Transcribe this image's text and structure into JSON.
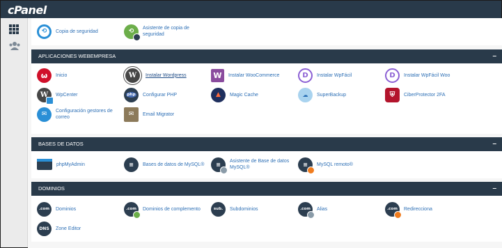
{
  "app": {
    "logo": "cPanel"
  },
  "sidebar": [
    {
      "icon": "grid-icon"
    },
    {
      "icon": "users-icon"
    }
  ],
  "top_items": [
    {
      "label": "Copia de seguridad",
      "icon": "backup-icon"
    },
    {
      "label": "Asistente de copia de seguridad",
      "icon": "backup-wizard-icon"
    }
  ],
  "sections": {
    "webempresa": {
      "title": "APLICACIONES WEBEMPRESA",
      "collapse": "–",
      "items": [
        {
          "label": "Inicio",
          "icon": "webempresa-logo-icon"
        },
        {
          "label": "Instalar Wordpress",
          "icon": "wordpress-icon"
        },
        {
          "label": "Instalar WooCommerce",
          "icon": "woocommerce-icon"
        },
        {
          "label": "Instalar WpFácil",
          "icon": "wpfacil-icon"
        },
        {
          "label": "Instalar WpFácil Woo",
          "icon": "wpfacil-woo-icon"
        },
        {
          "label": "WpCenter",
          "icon": "wpcenter-icon"
        },
        {
          "label": "Configurar PHP",
          "icon": "php-icon"
        },
        {
          "label": "Magic Cache",
          "icon": "rocket-icon"
        },
        {
          "label": "SuperBackup",
          "icon": "superbackup-icon"
        },
        {
          "label": "CiberProtector 2FA",
          "icon": "shield-icon"
        },
        {
          "label": "Configuración gestores de correo",
          "icon": "mail-config-icon"
        },
        {
          "label": "Email Migrator",
          "icon": "email-migrator-icon"
        }
      ]
    },
    "databases": {
      "title": "BASES DE DATOS",
      "collapse": "–",
      "items": [
        {
          "label": "phpMyAdmin",
          "icon": "phpmyadmin-icon"
        },
        {
          "label": "Bases de datos de MySQL®",
          "icon": "database-icon"
        },
        {
          "label": "Asistente de Base de datos MySQL®",
          "icon": "database-wizard-icon"
        },
        {
          "label": "MySQL remoto®",
          "icon": "remote-mysql-icon"
        }
      ]
    },
    "domains": {
      "title": "DOMINIOS",
      "collapse": "–",
      "items": [
        {
          "label": "Dominios",
          "icon": "domain-icon",
          "glyph": ".com"
        },
        {
          "label": "Dominios de complemento",
          "icon": "addon-domain-icon",
          "glyph": ".com"
        },
        {
          "label": "Subdominios",
          "icon": "subdomain-icon",
          "glyph": "sub."
        },
        {
          "label": "Alias",
          "icon": "alias-icon",
          "glyph": ".com"
        },
        {
          "label": "Redirecciona",
          "icon": "redirect-icon",
          "glyph": ".com"
        },
        {
          "label": "Zone Editor",
          "icon": "dns-icon",
          "glyph": "DNS"
        }
      ]
    }
  },
  "colors": {
    "header": "#293a4a",
    "link": "#2d6fb5",
    "dark_icon": "#2c3e50"
  }
}
